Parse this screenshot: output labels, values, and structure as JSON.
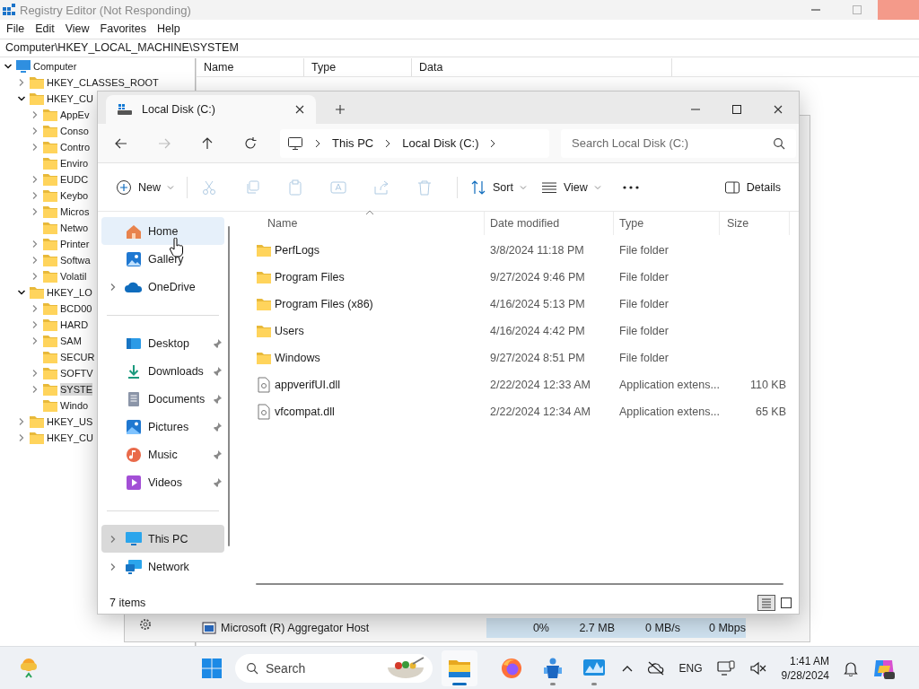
{
  "registry": {
    "title": "Registry Editor (Not Responding)",
    "menu": [
      "File",
      "Edit",
      "View",
      "Favorites",
      "Help"
    ],
    "address": "Computer\\HKEY_LOCAL_MACHINE\\SYSTEM",
    "columns": [
      "Name",
      "Type",
      "Data"
    ],
    "tree": [
      {
        "label": "Computer",
        "kind": "computer",
        "expandable": true,
        "expanded": true,
        "selected": false,
        "children": [
          {
            "label": "HKEY_CLASSES_ROOT",
            "kind": "folder",
            "expandable": true,
            "expanded": false,
            "selected": false
          },
          {
            "label": "HKEY_CU",
            "kind": "folder",
            "expandable": true,
            "expanded": true,
            "selected": false,
            "children": [
              {
                "label": "AppEv",
                "kind": "folder",
                "expandable": true,
                "expanded": false,
                "selected": false
              },
              {
                "label": "Conso",
                "kind": "folder",
                "expandable": true,
                "expanded": false,
                "selected": false
              },
              {
                "label": "Contro",
                "kind": "folder",
                "expandable": true,
                "expanded": false,
                "selected": false
              },
              {
                "label": "Enviro",
                "kind": "folder",
                "expandable": false,
                "selected": false
              },
              {
                "label": "EUDC",
                "kind": "folder",
                "expandable": true,
                "expanded": false,
                "selected": false
              },
              {
                "label": "Keybo",
                "kind": "folder",
                "expandable": true,
                "expanded": false,
                "selected": false
              },
              {
                "label": "Micros",
                "kind": "folder",
                "expandable": true,
                "expanded": false,
                "selected": false
              },
              {
                "label": "Netwo",
                "kind": "folder",
                "expandable": false,
                "selected": false
              },
              {
                "label": "Printer",
                "kind": "folder",
                "expandable": true,
                "expanded": false,
                "selected": false
              },
              {
                "label": "Softwa",
                "kind": "folder",
                "expandable": true,
                "expanded": false,
                "selected": false
              },
              {
                "label": "Volatil",
                "kind": "folder",
                "expandable": true,
                "expanded": false,
                "selected": false
              }
            ]
          },
          {
            "label": "HKEY_LO",
            "kind": "folder",
            "expandable": true,
            "expanded": true,
            "selected": false,
            "children": [
              {
                "label": "BCD00",
                "kind": "folder",
                "expandable": true,
                "expanded": false,
                "selected": false
              },
              {
                "label": "HARD",
                "kind": "folder",
                "expandable": true,
                "expanded": false,
                "selected": false
              },
              {
                "label": "SAM",
                "kind": "folder",
                "expandable": true,
                "expanded": false,
                "selected": false
              },
              {
                "label": "SECUR",
                "kind": "folder",
                "expandable": false,
                "selected": false
              },
              {
                "label": "SOFTV",
                "kind": "folder",
                "expandable": true,
                "expanded": false,
                "selected": false
              },
              {
                "label": "SYSTE",
                "kind": "folder",
                "expandable": true,
                "expanded": false,
                "selected": true
              },
              {
                "label": "Windo",
                "kind": "folder",
                "expandable": false,
                "selected": false
              }
            ]
          },
          {
            "label": "HKEY_US",
            "kind": "folder",
            "expandable": true,
            "expanded": false,
            "selected": false
          },
          {
            "label": "HKEY_CU",
            "kind": "folder",
            "expandable": true,
            "expanded": false,
            "selected": false
          }
        ]
      }
    ]
  },
  "task_manager": {
    "row": {
      "name": "Microsoft (R) Aggregator Host",
      "cells": [
        "0%",
        "2.7 MB",
        "0 MB/s",
        "0 Mbps"
      ]
    }
  },
  "explorer": {
    "tab": {
      "title": "Local Disk (C:)"
    },
    "nav_buttons": [
      {
        "kind": "back",
        "disabled": false
      },
      {
        "kind": "forward",
        "disabled": true
      },
      {
        "kind": "up",
        "disabled": false
      },
      {
        "kind": "refresh",
        "disabled": false
      }
    ],
    "breadcrumb": [
      "This PC",
      "Local Disk (C:)"
    ],
    "search": {
      "placeholder": "Search Local Disk (C:)"
    },
    "new_button": {
      "label": "New"
    },
    "actions": [
      {
        "kind": "cut",
        "disabled": true
      },
      {
        "kind": "copy",
        "disabled": true
      },
      {
        "kind": "paste",
        "disabled": true
      },
      {
        "kind": "rename",
        "disabled": true
      },
      {
        "kind": "share",
        "disabled": true
      },
      {
        "kind": "delete",
        "disabled": true
      }
    ],
    "sort_button": {
      "label": "Sort"
    },
    "view_button": {
      "label": "View"
    },
    "details_button": {
      "label": "Details"
    },
    "sidebar": {
      "groups": [
        {
          "items": [
            {
              "label": "Home",
              "kind": "home",
              "hovered": true,
              "selected": false
            },
            {
              "label": "Gallery",
              "kind": "gallery",
              "hovered": false,
              "selected": false
            },
            {
              "label": "OneDrive",
              "kind": "onedrive",
              "expanded": false,
              "hovered": false,
              "selected": false
            }
          ]
        },
        {
          "items": [
            {
              "label": "Desktop",
              "kind": "desktop",
              "pinned": true,
              "hovered": false,
              "selected": false
            },
            {
              "label": "Downloads",
              "kind": "downloads",
              "pinned": true,
              "hovered": false,
              "selected": false
            },
            {
              "label": "Documents",
              "kind": "documents",
              "pinned": true,
              "hovered": false,
              "selected": false
            },
            {
              "label": "Pictures",
              "kind": "pictures",
              "pinned": true,
              "hovered": false,
              "selected": false
            },
            {
              "label": "Music",
              "kind": "music",
              "pinned": true,
              "hovered": false,
              "selected": false
            },
            {
              "label": "Videos",
              "kind": "videos",
              "pinned": true,
              "hovered": false,
              "selected": false
            }
          ]
        },
        {
          "items": [
            {
              "label": "This PC",
              "kind": "pc",
              "expanded": false,
              "hovered": false,
              "selected": true
            },
            {
              "label": "Network",
              "kind": "network",
              "expanded": false,
              "hovered": false,
              "selected": false
            }
          ]
        }
      ]
    },
    "columns": [
      {
        "label": "Name",
        "sorted": true
      },
      {
        "label": "Date modified",
        "sorted": false
      },
      {
        "label": "Type",
        "sorted": false
      },
      {
        "label": "Size",
        "sorted": false
      }
    ],
    "rows": [
      {
        "kind": "folder",
        "name": "PerfLogs",
        "date": "3/8/2024 11:18 PM",
        "type": "File folder"
      },
      {
        "kind": "folder",
        "name": "Program Files",
        "date": "9/27/2024 9:46 PM",
        "type": "File folder"
      },
      {
        "kind": "folder",
        "name": "Program Files (x86)",
        "date": "4/16/2024 5:13 PM",
        "type": "File folder"
      },
      {
        "kind": "folder",
        "name": "Users",
        "date": "4/16/2024 4:42 PM",
        "type": "File folder"
      },
      {
        "kind": "folder",
        "name": "Windows",
        "date": "9/27/2024 8:51 PM",
        "type": "File folder"
      },
      {
        "kind": "file",
        "name": "appverifUI.dll",
        "date": "2/22/2024 12:33 AM",
        "type": "Application extens...",
        "size": "110 KB"
      },
      {
        "kind": "file",
        "name": "vfcompat.dll",
        "date": "2/22/2024 12:34 AM",
        "type": "Application extens...",
        "size": "65 KB"
      }
    ],
    "status": "7 items",
    "views": [
      {
        "kind": "details",
        "selected": true
      },
      {
        "kind": "tiles",
        "selected": false
      }
    ]
  },
  "taskbar": {
    "search": {
      "placeholder": "Search"
    },
    "apps": [
      {
        "kind": "explorer",
        "running": true,
        "active": true
      },
      {
        "kind": "firefox",
        "running": false,
        "active": false
      },
      {
        "kind": "people",
        "running": true,
        "active": false
      },
      {
        "kind": "monitor",
        "running": true,
        "active": false
      }
    ],
    "language": "ENG",
    "time": "1:41 AM",
    "date": "9/28/2024"
  }
}
